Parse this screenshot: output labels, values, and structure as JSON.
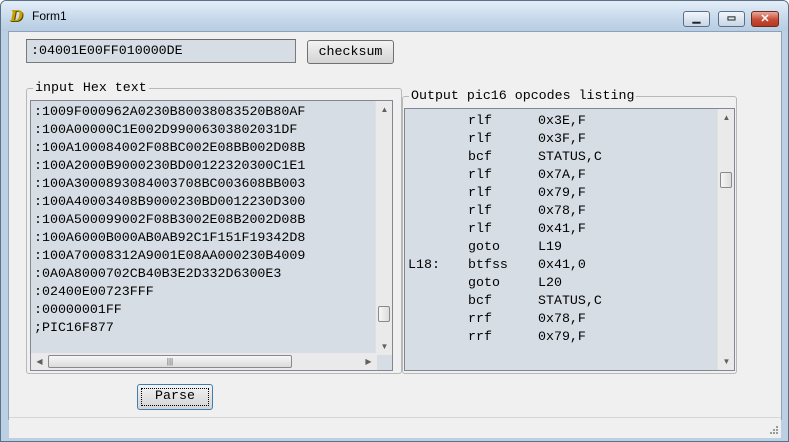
{
  "window": {
    "title": "Form1",
    "icon": "delphi-app-icon",
    "minimize_glyph": "▁",
    "maximize_glyph": "▭",
    "close_glyph": "✕"
  },
  "hex_field": {
    "value": ":04001E00FF010000DE"
  },
  "buttons": {
    "checksum": "checksum",
    "parse": "Parse"
  },
  "input_group": {
    "label": "input Hex text",
    "lines": [
      ":1009F000962A0230B80038083520B80AF",
      ":100A00000C1E002D99006303802031DF",
      ":100A100084002F08BC002E08BB002D08B",
      ":100A2000B9000230BD00122320300C1E1",
      ":100A3000893084003708BC003608BB003",
      ":100A40003408B9000230BD0012230D300",
      ":100A500099002F08B3002E08B2002D08B",
      ":100A6000B000AB0AB92C1F151F19342D8",
      ":100A70008312A9001E08AA000230B4009",
      ":0A0A8000702CB40B3E2D332D6300E3",
      ":02400E00723FFF",
      ":00000001FF",
      ";PIC16F877"
    ]
  },
  "output_group": {
    "label": "Output pic16 opcodes listing",
    "rows": [
      {
        "label": "",
        "op": "rlf",
        "arg": "0x3E,F"
      },
      {
        "label": "",
        "op": "rlf",
        "arg": "0x3F,F"
      },
      {
        "label": "",
        "op": "bcf",
        "arg": "STATUS,C"
      },
      {
        "label": "",
        "op": "rlf",
        "arg": "0x7A,F"
      },
      {
        "label": "",
        "op": "rlf",
        "arg": "0x79,F"
      },
      {
        "label": "",
        "op": "rlf",
        "arg": "0x78,F"
      },
      {
        "label": "",
        "op": "rlf",
        "arg": "0x41,F"
      },
      {
        "label": "",
        "op": "goto",
        "arg": "L19"
      },
      {
        "label": "L18:",
        "op": "btfss",
        "arg": "0x41,0"
      },
      {
        "label": "",
        "op": "goto",
        "arg": "L20"
      },
      {
        "label": "",
        "op": "bcf",
        "arg": "STATUS,C"
      },
      {
        "label": "",
        "op": "rrf",
        "arg": "0x78,F"
      },
      {
        "label": "",
        "op": "rrf",
        "arg": "0x79,F"
      }
    ]
  },
  "scrollbars": {
    "input_vertical_position": 0.92,
    "output_vertical_position": 0.22,
    "input_horizontal_position": 0.0,
    "thumb_grip_glyph": "|||"
  }
}
